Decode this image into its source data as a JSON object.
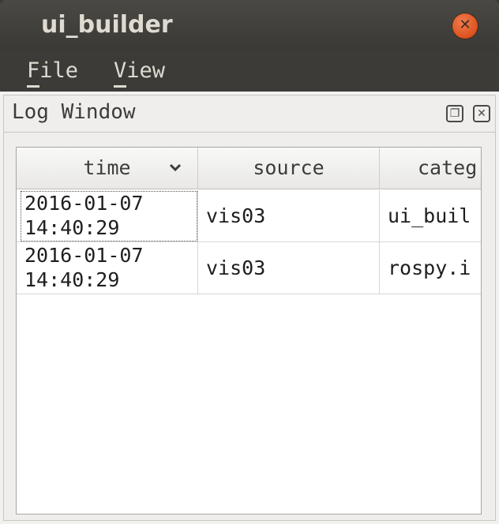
{
  "window": {
    "title": "ui_builder",
    "close_icon": "close-icon"
  },
  "menu": {
    "file": "File",
    "view": "View"
  },
  "dock": {
    "title": "Log Window",
    "float_icon": "float-icon",
    "close_icon": "close-icon"
  },
  "table": {
    "columns": [
      "time",
      "source",
      "categ"
    ],
    "sort_icon": "chevron-down-icon",
    "rows": [
      {
        "time_date": "2016-01-07",
        "time_clock": "14:40:29",
        "source": "vis03",
        "category": "ui_buil"
      },
      {
        "time_date": "2016-01-07",
        "time_clock": "14:40:29",
        "source": "vis03",
        "category": "rospy.i"
      }
    ]
  },
  "scrollbar": {
    "left_icon": "arrow-left-icon",
    "right_icon": "arrow-right-icon",
    "position": 0
  },
  "colors": {
    "titlebar": "#3c3b37",
    "close_button": "#e0582a",
    "panel": "#f2f1f0"
  }
}
